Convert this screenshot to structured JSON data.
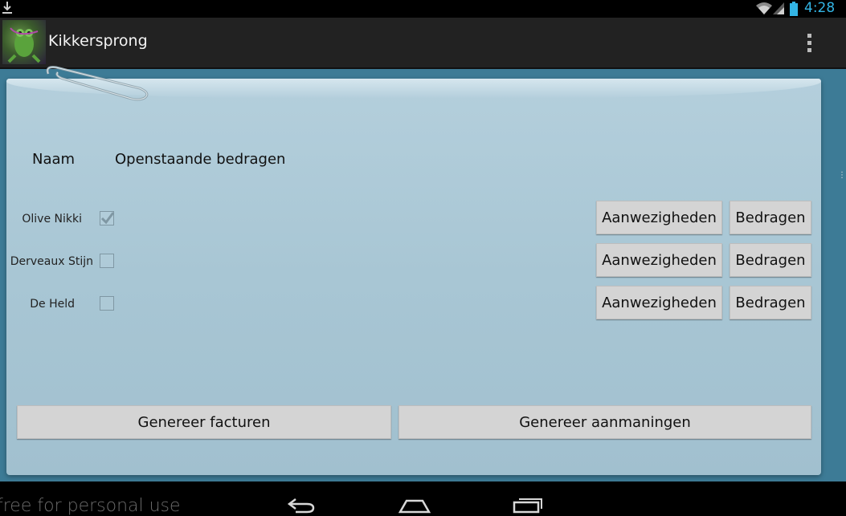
{
  "status_bar": {
    "time": "4:28",
    "icons": [
      "download-icon",
      "wifi-icon",
      "signal-icon",
      "battery-icon"
    ],
    "accent_color": "#33b5e5"
  },
  "action_bar": {
    "title": "Kikkersprong",
    "icons": [
      "app-logo",
      "overflow-menu-icon"
    ]
  },
  "table": {
    "headers": {
      "name": "Naam",
      "amounts": "Openstaande bedragen"
    },
    "rows": [
      {
        "name": "Olive Nikki",
        "checked": true,
        "attendance_label": "Aanwezigheden",
        "amounts_label": "Bedragen"
      },
      {
        "name": "Derveaux Stijn",
        "checked": false,
        "attendance_label": "Aanwezigheden",
        "amounts_label": "Bedragen"
      },
      {
        "name": "De Held",
        "checked": false,
        "attendance_label": "Aanwezigheden",
        "amounts_label": "Bedragen"
      }
    ]
  },
  "actions": {
    "generate_invoices": "Genereer facturen",
    "generate_reminders": "Genereer aanmaningen"
  },
  "nav_bar": {
    "watermark": "free for personal use",
    "icons": [
      "back-icon",
      "home-icon",
      "recent-apps-icon"
    ]
  }
}
